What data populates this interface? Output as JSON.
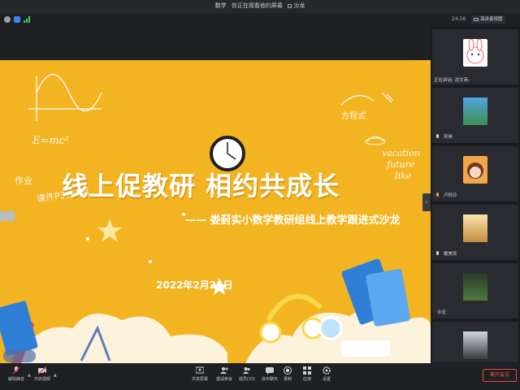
{
  "window": {
    "title_left": "数学",
    "title_sharing": "你正在观看他的屏幕",
    "title_right": "沙龙"
  },
  "status": {
    "time": "24:56",
    "presenter_view": "演讲者视图"
  },
  "slide": {
    "title": "线上促教研  相约共成长",
    "subtitle": "—— 娄葑实小数学教研组线上教学跟进式沙龙",
    "date": "2022年2月23日",
    "deco_formula": "E=mc²",
    "deco_homework": "作业",
    "deco_lesson": "课件P3练4题",
    "deco_equation": "方程式",
    "deco_vacation": "vacation",
    "deco_future": "future",
    "deco_like": "like"
  },
  "participants": {
    "speaking_label": "正在讲话: 沈文英;",
    "list": [
      {
        "name": ""
      },
      {
        "name": "吴昊"
      },
      {
        "name": "卢栎玲"
      },
      {
        "name": "戴美奕"
      },
      {
        "name": "许宏"
      },
      {
        "name": ""
      }
    ]
  },
  "toolbar": {
    "mute": "解除静音",
    "video": "开启视频",
    "share": "共享屏幕",
    "invite": "邀请参会",
    "members": "成员(33)",
    "chat": "会中聊天",
    "record": "录制",
    "apps": "应用",
    "settings": "设置",
    "leave": "离开会议"
  },
  "colors": {
    "slide_bg": "#f3b421",
    "leave_red": "#e5463c",
    "shield_blue": "#3b82f6"
  }
}
